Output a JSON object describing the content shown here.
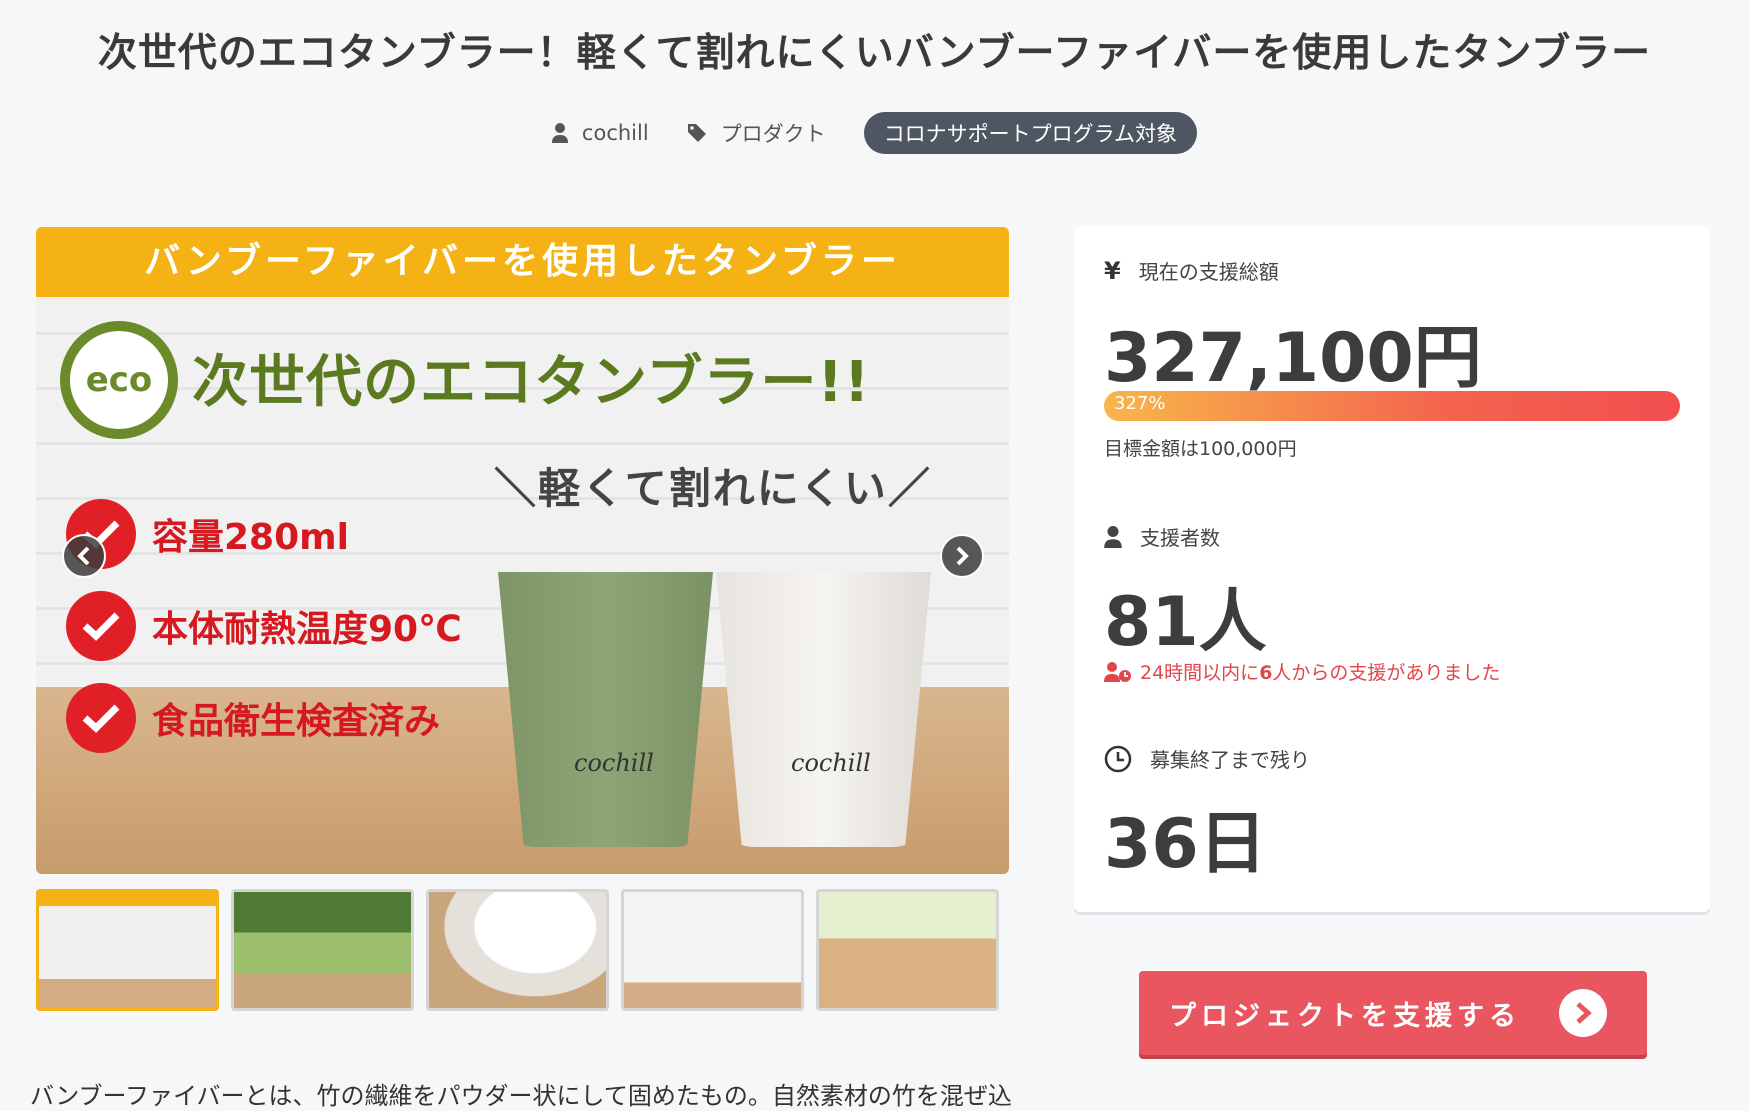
{
  "page": {
    "title": "次世代のエコタンブラー！軽くて割れにくいバンブーファイバーを使用したタンブラー",
    "author": "cochill",
    "category": "プロダクト",
    "badge": "コロナサポートプログラム対象",
    "body_text": "バンブーファイバーとは、竹の繊維をパウダー状にして固めたもの。自然素材の竹を混ぜ込"
  },
  "hero": {
    "band": "バンブーファイバーを使用したタンブラー",
    "eco": "eco",
    "headline": "次世代のエコタンブラー!!",
    "sub": "＼軽くて割れにくい／",
    "features": [
      "容量280ml",
      "本体耐熱温度90℃",
      "食品衛生検査済み"
    ],
    "cup_brand": "cochill"
  },
  "stats": {
    "total_label": "現在の支援総額",
    "total_value": "327,100円",
    "percent_label": "327%",
    "progress": 1.0,
    "goal": "目標金額は100,000円",
    "supporters_label": "支援者数",
    "supporters_value": "81人",
    "recent_pre": "24時間以内に",
    "recent_num": "6",
    "recent_post": "人からの支援がありました",
    "remaining_label": "募集終了まで残り",
    "remaining_value": "36日"
  },
  "cta": {
    "label": "プロジェクトを支援する"
  },
  "colors": {
    "accent": "#e9565f",
    "band": "#f5b214",
    "badge": "#4e5661"
  }
}
